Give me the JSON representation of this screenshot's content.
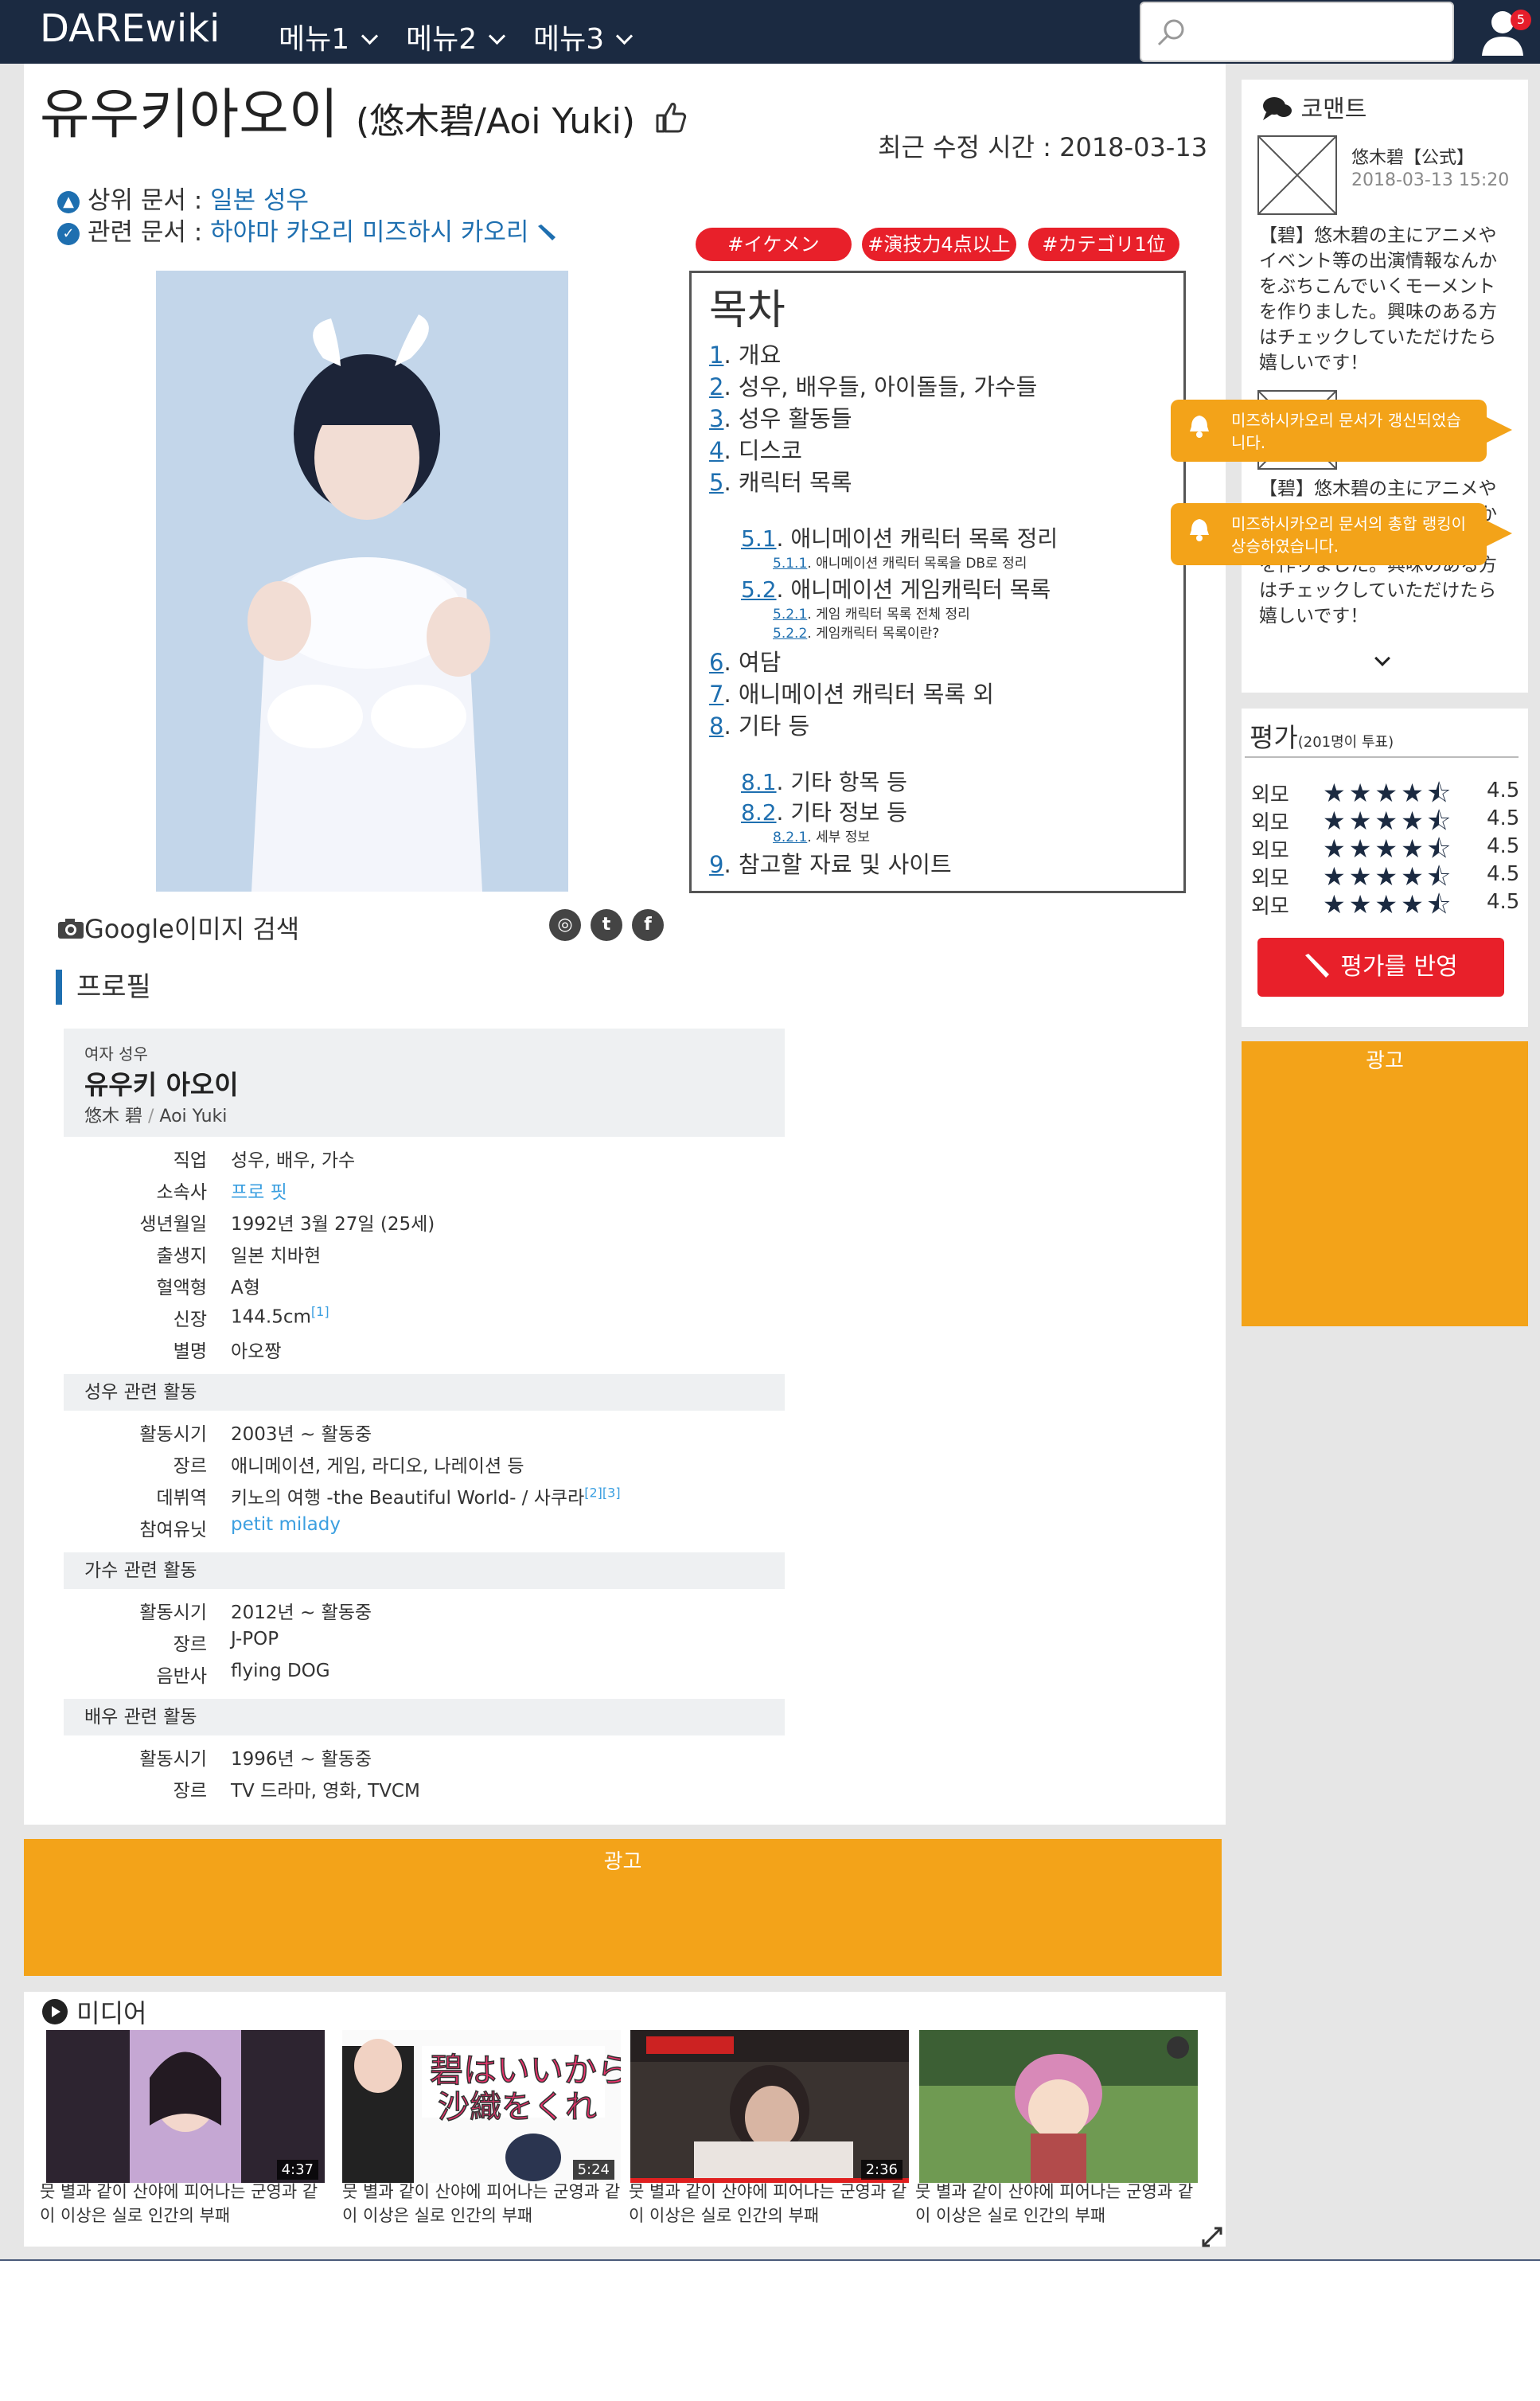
{
  "header": {
    "logo": "DAREwiki",
    "menus": [
      "메뉴1",
      "메뉴2",
      "메뉴3"
    ],
    "search_placeholder": "",
    "notification_count": "5"
  },
  "article": {
    "title": "유우키아오이",
    "subtitle": "(悠木碧/Aoi Yuki)",
    "modified": "최근 수정 시간 : 2018-03-13",
    "parent_label": "상위 문서 :",
    "parent_link": "일본 성우",
    "related_label": "관련 문서 :",
    "related_link": "하야마 카오리 미즈하시 카오리",
    "tags": [
      "#イケメン",
      "#演技力4点以上",
      "#カテゴリ1位"
    ],
    "google_image": "Google이미지 검색"
  },
  "toc": {
    "heading": "목차",
    "items": [
      {
        "num": "1",
        "label": "개요"
      },
      {
        "num": "2",
        "label": "성우, 배우들, 아이돌들, 가수들"
      },
      {
        "num": "3",
        "label": "성우 활동들"
      },
      {
        "num": "4",
        "label": "디스코"
      },
      {
        "num": "5",
        "label": "캐릭터 목록"
      },
      {
        "num": "5.1",
        "label": "애니메이션 캐릭터 목록 정리"
      },
      {
        "num": "5.1.1",
        "label": "애니메이션 캐릭터 목록을 DB로 정리"
      },
      {
        "num": "5.2",
        "label": "애니메이션 게임캐릭터 목록"
      },
      {
        "num": "5.2.1",
        "label": "게임 캐릭터 목록 전체 정리"
      },
      {
        "num": "5.2.2",
        "label": "게임캐릭터 목록이란?"
      },
      {
        "num": "6",
        "label": "여담"
      },
      {
        "num": "7",
        "label": "애니메이션 캐릭터 목록 외"
      },
      {
        "num": "8",
        "label": "기타 등"
      },
      {
        "num": "8.1",
        "label": "기타 항목 등"
      },
      {
        "num": "8.2",
        "label": "기타 정보 등"
      },
      {
        "num": "8.2.1",
        "label": "세부 정보"
      },
      {
        "num": "9",
        "label": "참고할 자료 및 사이트"
      }
    ]
  },
  "profile": {
    "heading": "프로필",
    "kind": "여자 성우",
    "name": "유우키 아오이",
    "name_jp": "悠木 碧",
    "name_sep": "/",
    "name_en": "Aoi Yuki",
    "basic": [
      {
        "label": "직업",
        "value": "성우, 배우, 가수"
      },
      {
        "label": "소속사",
        "value": "프로 핏"
      },
      {
        "label": "생년월일",
        "value": "1992년 3월 27일 (25세)"
      },
      {
        "label": "출생지",
        "value": "일본 치바현"
      },
      {
        "label": "혈액형",
        "value": "A형"
      },
      {
        "label": "신장",
        "value": "144.5cm",
        "ref": "[1]"
      },
      {
        "label": "별명",
        "value": "아오짱"
      }
    ],
    "sections": [
      {
        "title": "성우 관련 활동",
        "rows": [
          {
            "label": "활동시기",
            "value": "2003년 ~ 활동중"
          },
          {
            "label": "장르",
            "value": "애니메이션, 게임, 라디오, 나레이션 등"
          },
          {
            "label": "데뷔역",
            "value": "키노의 여행 -the Beautiful World- / 사쿠라",
            "ref": "[2][3]"
          },
          {
            "label": "참여유닛",
            "value": "petit milady"
          }
        ]
      },
      {
        "title": "가수 관련 활동",
        "rows": [
          {
            "label": "활동시기",
            "value": "2012년 ~ 활동중"
          },
          {
            "label": "장르",
            "value": "J-POP"
          },
          {
            "label": "음반사",
            "value": "flying DOG"
          }
        ]
      },
      {
        "title": "배우 관련 활동",
        "rows": [
          {
            "label": "활동시기",
            "value": "1996년 ~ 활동중"
          },
          {
            "label": "장르",
            "value": "TV 드라마, 영화, TVCM"
          }
        ]
      }
    ]
  },
  "ads": {
    "label": "광고"
  },
  "media": {
    "heading": "미디어",
    "videos": [
      {
        "duration": "4:37",
        "caption": "뭇 별과 같이 산야에 피어나는 군영과 같이 이상은 실로 인간의 부패"
      },
      {
        "duration": "5:24",
        "caption": "뭇 별과 같이 산야에 피어나는 군영과 같이 이상은 실로 인간의 부패"
      },
      {
        "duration": "2:36",
        "caption": "뭇 별과 같이 산야에 피어나는 군영과 같이 이상은 실로 인간의 부패"
      },
      {
        "duration": "",
        "caption": "뭇 별과 같이 산야에 피어나는 군영과 같이 이상은 실로 인간의 부패"
      }
    ]
  },
  "comments": {
    "heading": "코맨트",
    "items": [
      {
        "author": "悠木碧【公式】",
        "time": "2018-03-13 15:20",
        "text": "【碧】悠木碧の主にアニメやイベント等の出演情報なんかをぶちこんでいくモーメントを作りました。興味のある方はチェックしていただけたら嬉しいです！"
      },
      {
        "author": "",
        "time": "",
        "text": "【碧】悠木碧の主にアニメやイベント等の出演情報なんかをぶちこんでいくモーメントを作りました。興味のある方はチェックしていただけたら嬉しいです！"
      }
    ]
  },
  "notifications": [
    "미즈하시카오리 문서가 갱신되었습니다.",
    "미즈하시카오리 문서의 총합 랭킹이 상승하였습니다."
  ],
  "rating": {
    "heading": "평가",
    "votes": "(201명이 투표)",
    "rows": [
      {
        "label": "외모",
        "score": "4.5",
        "value": 4.5
      },
      {
        "label": "외모",
        "score": "4.5",
        "value": 4.5
      },
      {
        "label": "외모",
        "score": "4.5",
        "value": 4.5
      },
      {
        "label": "외모",
        "score": "4.5",
        "value": 4.5
      },
      {
        "label": "외모",
        "score": "4.5",
        "value": 4.5
      }
    ],
    "button": "평가를 반영"
  },
  "colors": {
    "nav": "#1b2a41",
    "accent": "#1e6fb0",
    "tag": "#e8202a",
    "ad": "#f3a319"
  }
}
